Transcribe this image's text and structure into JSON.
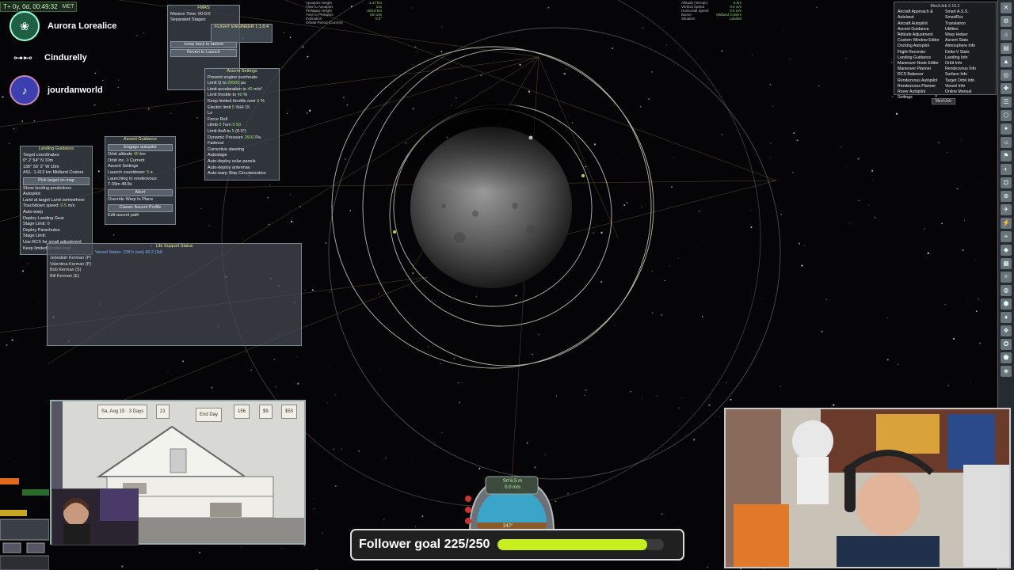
{
  "overlay": {
    "met": {
      "time": "T+ 0y, 0d, 00:49:32",
      "label": "MET"
    },
    "chat_users": [
      "Aurora Lorealice",
      "Cindurelly",
      "jourdanworld"
    ]
  },
  "windows": {
    "fmrs": {
      "title": "FMRS",
      "rows": [
        "Mission Time: 00:0:0",
        "Separated Stages:"
      ],
      "buttons": [
        "Jump back to launch",
        "Revert to Launch"
      ]
    },
    "kerbal_engineer": {
      "title": "FLIGHT ENGINEER 1.1.8.4"
    },
    "ascent_settings": {
      "title": "Ascent Settings",
      "rows": [
        "Prevent engine overheats",
        "Limit Q to",
        "Limit acceleration to",
        "Limit throttle to",
        "Keep limited throttle over",
        "Electric limit",
        "Lo",
        "Force Roll",
        "climb",
        "Limit AoA to",
        "Dynamic Pressure",
        "Fadeout",
        "Corrective steering",
        "Autostage",
        "Auto-deploy solar panels",
        "Auto-deploy antennas",
        "Auto-warp"
      ],
      "values": {
        "limit_q": "20000",
        "limit_q_unit": "pa",
        "limit_accel": "40",
        "limit_accel_unit": "m/s²",
        "limit_throttle": "40",
        "keep_limited": "5",
        "electric": "5",
        "hi": "%Hi 15",
        "climb_hdg": "0",
        "turn_hdg": "0",
        "aoa": "5",
        "aoa_deg": "(0.0°)",
        "dyn_pressure": "2500",
        "dyn_unit": "Pa",
        "skip_circ": "Skip Circularization",
        "climb_turn_labels": "Turn",
        "climb_extra": "50"
      }
    },
    "ascent_guidance": {
      "title": "Ascent Guidance",
      "engage": "Engage autopilot",
      "orbit_altitude_label": "Orbit altitude",
      "orbit_altitude": "45",
      "orbit_altitude_unit": "km",
      "orbit_inc_label": "Orbit inc.",
      "orbit_inc": "0",
      "current": "Current",
      "ascent_settings": "Ascent Settings",
      "launch_countdown_label": "Launch countdown:",
      "launch_countdown": "5",
      "launch_countdown_unit": "s",
      "rendezvous": "Launching to rendezvous:",
      "rendezvous_time": "T-39m 48.8s",
      "abort": "Abort",
      "override": "Override Warp to Plane",
      "classic": "Classic Ascent Profile",
      "edit_path": "Edit ascent path"
    },
    "landing_guidance": {
      "title": "Landing Guidance",
      "rows": [
        "Target coordinates:",
        "0° 2' 54\" N",
        "136° 55' 2\" W",
        "ASL: 1,413 km Midland Craters",
        "Pick target on map",
        "Show landing predictions",
        "Autopilot:",
        "Land at target  Land somewhere",
        "Touchdown speed:",
        "Auto-warp",
        "Deploy Landing Gear",
        "Stage Limit:",
        "Deploy Parachutes",
        "Stage Limit:",
        "Use RCS for small adjustment",
        "Keep limited throttle over"
      ],
      "touchdown_speed": "0.5",
      "touchdown_unit": "m/s",
      "step_a": "10m",
      "step_b": "10m",
      "stage_limit": "0"
    },
    "life_support": {
      "title": "Life Support Status",
      "header": "Vessel Name: 238 h (est)   40.2 (3d)",
      "crew": [
        "Jebediah Kerman (P)",
        "Valentina Kerman (P)",
        "Bob Kerman (S)",
        "Bill Kerman (E)"
      ]
    }
  },
  "mechjeb": {
    "title": "MechJeb 2.15.2",
    "left": [
      "Aircraft Approach & Autoland",
      "Aircraft Autopilot",
      "Ascent Guidance",
      "Attitude Adjustment",
      "Custom Window Editor",
      "Docking Autopilot",
      "Flight Recorder",
      "Landing Guidance",
      "Maneuver Node Editor",
      "Maneuver Planner",
      "RCS Balancer",
      "Rendezvous Autopilot",
      "Rendezvous Planner",
      "Rover Autopilot",
      "Settings"
    ],
    "right": [
      "Smart A.S.S.",
      "SmartRcs",
      "Translatron",
      "Utilities",
      "Warp Helper",
      "Ascent Stats",
      "Atmosphere Info",
      "Delta-V Stats",
      "Landing Info",
      "Orbit Info",
      "Rendezvous Info",
      "Surface Info",
      "Target Orbit Info",
      "Vessel Info",
      "Online Manual"
    ],
    "footer": "MechJeb"
  },
  "telemetry": {
    "left": [
      "Apoapsis Height",
      "Time to Apoapsis",
      "Periapsis Height",
      "Time to Periapsis",
      "Inclination",
      "Orbital Period (Current)"
    ],
    "left_vals": [
      "1.47 km",
      "14s",
      "-200.8 km",
      "8m 14s",
      "0.0°",
      "23,050m 0 (orbital)"
    ],
    "right": [
      "Altitude (Terrain)",
      "Vertical Speed",
      "Horizontal Speed",
      "Biome",
      "Situation"
    ],
    "right_vals": [
      "6.5m",
      "0.0 m/s",
      "0.0 m/s",
      "Midland Craters",
      "Landed"
    ]
  },
  "game": {
    "date": "Sa, Aug 15",
    "days": "3 Days",
    "end_day": "End Day",
    "money_a": "156",
    "money_b": "$9",
    "money_c": "$53",
    "time": "21"
  },
  "navball": {
    "speed_mode": "Srf 6.5 m",
    "speed": "0.0 m/s",
    "heading": "247°"
  },
  "follower_goal": {
    "label": "Follower goal 225/250",
    "current": 225,
    "target": 250
  },
  "colors": {
    "goal_fill": "#c7ee1e",
    "orbit_line": "#d8d8c8",
    "ui_title": "#e4e88f"
  }
}
